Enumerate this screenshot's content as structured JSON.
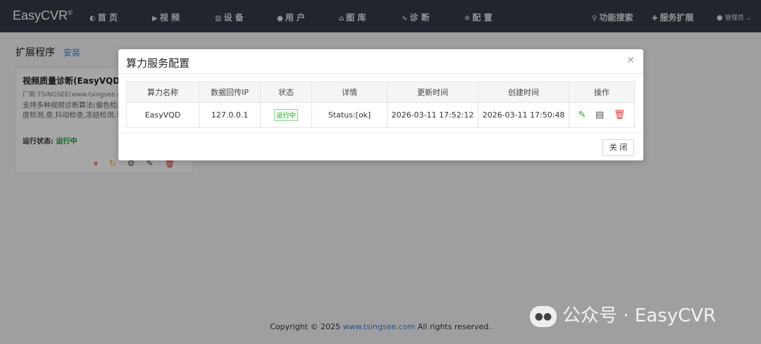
{
  "nav": {
    "brand": "EasyCVR",
    "brand_mark": "®",
    "items": [
      {
        "label": "首 页",
        "icon": "dashboard-icon"
      },
      {
        "label": "视 频",
        "icon": "play-icon"
      },
      {
        "label": "设 备",
        "icon": "device-icon"
      },
      {
        "label": "用 户",
        "icon": "user-icon"
      },
      {
        "label": "图 库",
        "icon": "gallery-icon"
      },
      {
        "label": "诊 断",
        "icon": "pulse-icon"
      },
      {
        "label": "配 置",
        "icon": "gear-icon"
      }
    ],
    "search": "功能搜索",
    "extensions": "服务扩展",
    "user": "管理员"
  },
  "page": {
    "title": "扩展程序",
    "install": "安装"
  },
  "card": {
    "name": "视频质量诊断(EasyVQD",
    "vendor": "厂商:TSINGSEE(www.tsingsee.co",
    "desc": "支持多种视频诊断算法(偏色检测,检查,噪声检测,对比度检测,查,抖动检查,冻结检测,马赛",
    "status_label": "运行状态:",
    "status_value": "运行中"
  },
  "modal": {
    "title": "算力服务配置",
    "close_label": "关 闭",
    "columns": [
      "算力名称",
      "数据回传IP",
      "状态",
      "详情",
      "更新时间",
      "创建时间",
      "操作"
    ],
    "rows": [
      {
        "name": "EasyVQD",
        "ip": "127.0.0.1",
        "status": "运行中",
        "detail": "Status:[ok]",
        "updated": "2026-03-11 17:52:12",
        "created": "2026-03-11 17:50:48"
      }
    ]
  },
  "footer": {
    "prefix": "Copyright © 2025",
    "link": "www.tsingsee.com",
    "suffix": "All rights reserved."
  },
  "watermark": {
    "text": "公众号 · EasyCVR"
  },
  "colors": {
    "nav_bg": "#333a45",
    "link": "#3b7fd1",
    "running": "#2a9d2a",
    "delete": "#e03b3b"
  }
}
